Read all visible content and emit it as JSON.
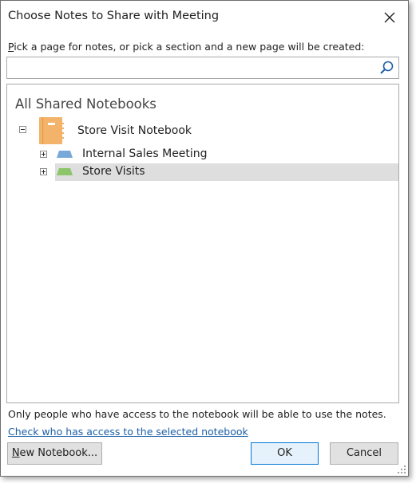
{
  "dialog": {
    "title": "Choose Notes to Share with Meeting",
    "close_label": "Close"
  },
  "instruction": {
    "accesskey": "P",
    "text": "ick a page for notes, or pick a section and a new page will be created:"
  },
  "search": {
    "value": "",
    "placeholder": ""
  },
  "tree": {
    "header": "All Shared Notebooks",
    "notebook": {
      "label": "Store Visit Notebook",
      "expanded": true,
      "color": "#f3b36a"
    },
    "sections": [
      {
        "label": "Internal Sales Meeting",
        "color": "#78a9d9",
        "selected": false
      },
      {
        "label": "Store Visits",
        "color": "#8cc56a",
        "selected": true
      }
    ]
  },
  "footer": {
    "note": "Only people who have access to the notebook will be able to use the notes.",
    "access_link": "Check who has access to the selected notebook"
  },
  "buttons": {
    "new_notebook_accesskey": "N",
    "new_notebook_rest": "ew Notebook...",
    "ok": "OK",
    "cancel": "Cancel"
  }
}
